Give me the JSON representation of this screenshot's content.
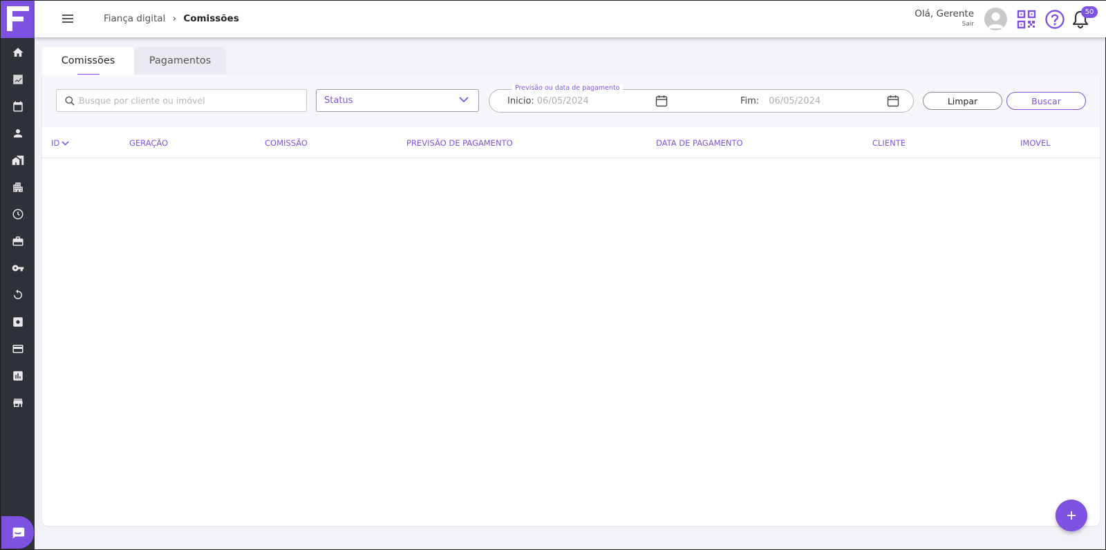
{
  "colors": {
    "accent": "#7d52e0",
    "sidebar": "#2e3138",
    "background": "#f3f2f8"
  },
  "header": {
    "breadcrumb": {
      "parent": "Fiança digital",
      "separator": "›",
      "current": "Comissões"
    },
    "user": {
      "greeting": "Olá, Gerente",
      "logout": "Sair"
    },
    "notifications": {
      "count": "50"
    }
  },
  "sidebar": {
    "items": [
      {
        "icon": "home-icon"
      },
      {
        "icon": "trending-chart-icon"
      },
      {
        "icon": "calendar-icon"
      },
      {
        "icon": "person-icon"
      },
      {
        "icon": "buildings-icon"
      },
      {
        "icon": "apartment-icon"
      },
      {
        "icon": "clock-icon"
      },
      {
        "icon": "briefcase-icon"
      },
      {
        "icon": "key-icon"
      },
      {
        "icon": "refresh-icon"
      },
      {
        "icon": "settings-box-icon"
      },
      {
        "icon": "credit-card-icon"
      },
      {
        "icon": "bar-chart-icon"
      },
      {
        "icon": "store-icon"
      }
    ]
  },
  "tabs": [
    {
      "label": "Comissões",
      "active": true
    },
    {
      "label": "Pagamentos",
      "active": false
    }
  ],
  "filters": {
    "search_placeholder": "Busque por cliente ou imóvel",
    "status_label": "Status",
    "date_range_legend": "Previsão ou data de pagamento",
    "start_label": "Inicio:",
    "start_value": "06/05/2024",
    "end_label": "Fim:",
    "end_value": "06/05/2024",
    "clear_button": "Limpar",
    "search_button": "Buscar"
  },
  "table": {
    "columns": [
      "ID",
      "GERAÇÃO",
      "COMISSÃO",
      "PREVISÃO DE PAGAMENTO",
      "DATA DE PAGAMENTO",
      "CLIENTE",
      "IMOVEL"
    ],
    "rows": []
  }
}
